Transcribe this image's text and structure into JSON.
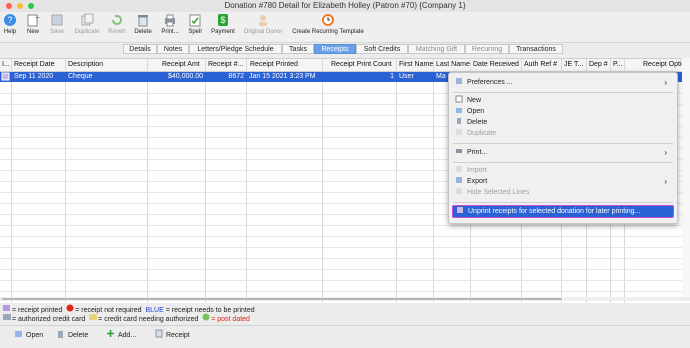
{
  "window": {
    "title": "Donation #780 Detail for Elizabeth Holley (Patron #70) {Company 1}"
  },
  "toolbar": [
    {
      "label": "Help",
      "enabled": true
    },
    {
      "label": "New",
      "enabled": true
    },
    {
      "label": "Save",
      "enabled": false
    },
    {
      "label": "Duplicate",
      "enabled": false
    },
    {
      "label": "Revert",
      "enabled": false
    },
    {
      "label": "Delete",
      "enabled": true
    },
    {
      "label": "Print...",
      "enabled": true
    },
    {
      "label": "Spell",
      "enabled": true
    },
    {
      "label": "Payment",
      "enabled": true
    },
    {
      "label": "Original Donor",
      "enabled": false
    },
    {
      "label": "Create Recurring Template",
      "enabled": true
    }
  ],
  "tabs": [
    {
      "label": "Details"
    },
    {
      "label": "Notes"
    },
    {
      "label": "Letters/Pledge Schedule"
    },
    {
      "label": "Tasks"
    },
    {
      "label": "Receipts"
    },
    {
      "label": "Soft Credits"
    },
    {
      "label": "Matching Gift"
    },
    {
      "label": "Recurring"
    },
    {
      "label": "Transactions"
    }
  ],
  "grid": {
    "headers": [
      "I...",
      "Receipt Date",
      "Description",
      "Receipt Amt",
      "Receipt #...",
      "Receipt Printed",
      "Receipt Print Count",
      "First Name",
      "Last Name",
      "Date Received",
      "Auth Ref #",
      "JE T...",
      "Dep #",
      "P...",
      "Receipt Optic"
    ],
    "row": {
      "receipt_date": "Sep 11 2020",
      "description": "Cheque",
      "amount": "$40,000.00",
      "receipt_no": "8672",
      "printed": "Jan 15 2021 3:23 PM",
      "print_count": "1",
      "first_name": "User",
      "last_name": "Ma"
    }
  },
  "legend": {
    "line1a": "= receipt printed",
    "line1b": "= receipt not required",
    "blue_word": "BLUE",
    "line1c": "= receipt needs to be printed",
    "line2a": "= authorized credit card",
    "line2b": "= credit card needing authorized",
    "line2c": "= post dated"
  },
  "bottom_buttons": [
    {
      "label": "Open"
    },
    {
      "label": "Delete"
    },
    {
      "label": "Add..."
    },
    {
      "label": "Receipt"
    }
  ],
  "context_menu": {
    "preferences": "Preferences ...",
    "new": "New",
    "open": "Open",
    "delete": "Delete",
    "duplicate": "Duplicate",
    "print": "Print...",
    "import": "Import",
    "export": "Export",
    "hide_selected": "Hide Selected Lines",
    "unprint": "Unprint receipts for selected donation for later printing..."
  },
  "colors": {
    "accent": "#2a62d6",
    "tab_active": "#6aa0e8",
    "post_dated": "#e0261b",
    "blue_word": "#1d3fd8"
  }
}
